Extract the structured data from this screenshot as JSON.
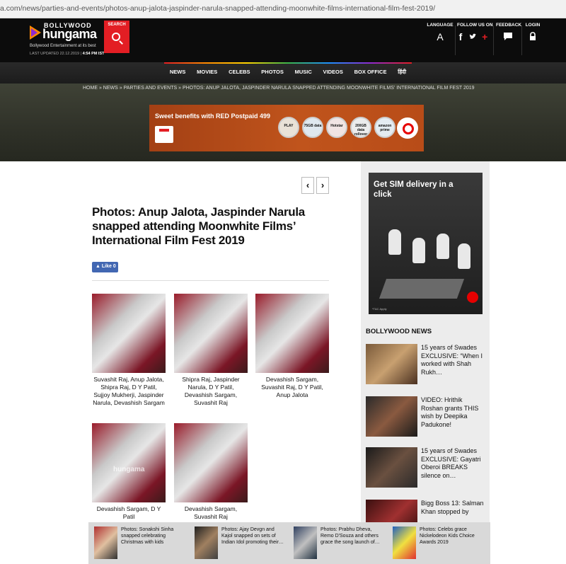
{
  "url": "a.com/news/parties-and-events/photos-anup-jalota-jaspinder-narula-snapped-attending-moonwhite-films-international-film-fest-2019/",
  "header": {
    "logo_top": "BOLLYWOOD",
    "logo_main": "hungama",
    "tagline": "Bollywood Entertainment at its best",
    "last_updated_label": "LAST UPDATED 22.12.2019 |",
    "last_updated_time": "4:54 PM IST",
    "search_label": "SEARCH",
    "language_label": "LANGUAGE",
    "language_icon": "A",
    "follow_label": "FOLLOW US ON",
    "feedback_label": "FEEDBACK",
    "login_label": "LOGIN",
    "icons": [
      "search-icon",
      "language-icon",
      "facebook-icon",
      "twitter-icon",
      "google-plus-icon",
      "feedback-icon",
      "lock-icon"
    ]
  },
  "nav": {
    "items": [
      "NEWS",
      "MOVIES",
      "CELEBS",
      "PHOTOS",
      "MUSIC",
      "VIDEOS",
      "BOX OFFICE",
      "हिंदी"
    ]
  },
  "breadcrumb": "HOME » NEWS » PARTIES AND EVENTS » PHOTOS: ANUP JALOTA, JASPINDER NARULA SNAPPED ATTENDING MOONWHITE FILMS' INTERNATIONAL FILM FEST 2019",
  "top_ad": {
    "headline": "Sweet benefits with RED Postpaid 499",
    "badges": [
      "PLAY",
      "75GB data",
      "Hotstar",
      "200GB data rollover",
      "amazon prime"
    ]
  },
  "article": {
    "title": "Photos: Anup Jalota, Jaspinder Narula snapped attending Moonwhite Films’ International Film Fest 2019",
    "like_label": "Like 0",
    "prev_icon": "‹",
    "next_icon": "›",
    "watermark": "hungama",
    "photos": [
      {
        "caption": "Suvashit Raj, Anup Jalota, Shipra Raj, D Y Patil, Sujjoy Mukherji, Jaspinder Narula, Devashish Sargam"
      },
      {
        "caption": "Shipra Raj, Jaspinder Narula, D Y Patil, Devashish Sargam, Suvashit Raj"
      },
      {
        "caption": "Devashish Sargam, Suvashit Raj, D Y Patil, Anup Jalota"
      },
      {
        "caption": "Devashish Sargam, D Y Patil"
      },
      {
        "caption": "Devashish Sargam, Suvashit Raj"
      }
    ]
  },
  "sidebar": {
    "ad_title": "Get SIM delivery in a click",
    "ad_tnc": "*T&C Apply",
    "news_heading": "BOLLYWOOD NEWS",
    "news": [
      {
        "title": "15 years of Swades EXCLUSIVE: “When I worked with Shah Rukh…"
      },
      {
        "title": "VIDEO: Hrithik Roshan grants THIS wish by Deepika Padukone!"
      },
      {
        "title": "15 years of Swades EXCLUSIVE: Gayatri Oberoi BREAKS silence on…"
      },
      {
        "title": "Bigg Boss 13: Salman Khan stopped by"
      }
    ]
  },
  "related": [
    {
      "title": "Photos: Sonakshi Sinha snapped celebrating Christmas with kids"
    },
    {
      "title": "Photos: Ajay Devgn and Kajol snapped on sets of Indian Idol promoting their…"
    },
    {
      "title": "Photos: Prabhu Dheva, Remo D'Souza and others grace the song launch of…"
    },
    {
      "title": "Photos: Celebs grace Nickelodeon Kids Choice Awards 2019"
    }
  ],
  "colors": {
    "brand_red": "#e31e24",
    "header_bg": "#0c0c0c",
    "facebook_blue": "#4267b2",
    "vodafone_red": "#e60000"
  }
}
